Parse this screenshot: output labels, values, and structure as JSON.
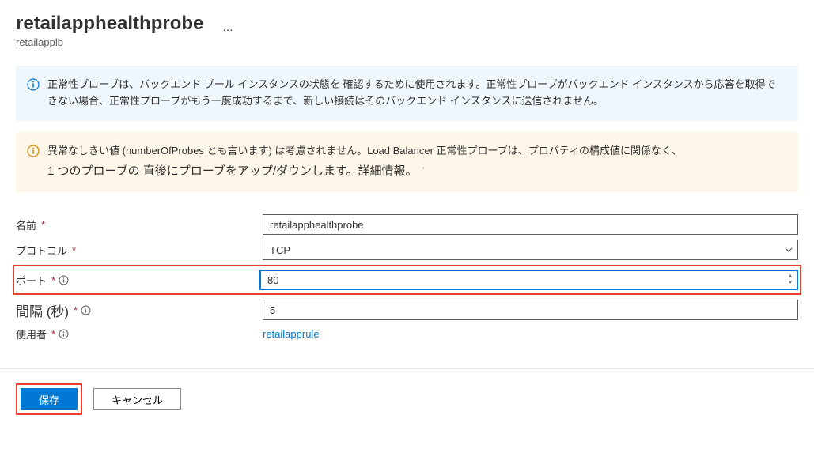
{
  "header": {
    "title": "retailapphealthprobe",
    "subtitle": "retailapplb",
    "ellipsis": "…"
  },
  "info1": {
    "text": "正常性プローブは、バックエンド プール インスタンスの状態を 確認するために使用されます。正常性プローブがバックエンド インスタンスから応答を取得できない場合、正常性プローブがもう一度成功するまで、新しい接続はそのバックエンド インスタンスに送信されません。"
  },
  "info2": {
    "text": "異常なしきい値 (numberOfProbes とも言います) は考慮されません。Load Balancer 正常性プローブは、プロパティの構成値に関係なく、",
    "text2": "1 つのプローブの 直後にプローブをアップ/ダウンします。詳細情報。"
  },
  "form": {
    "name": {
      "label": "名前",
      "value": "retailapphealthprobe"
    },
    "protocol": {
      "label": "プロトコル",
      "value": "TCP"
    },
    "port": {
      "label": "ポート",
      "value": "80"
    },
    "interval": {
      "label": "間隔 (秒)",
      "value": "5"
    },
    "usedBy": {
      "label": "使用者",
      "value": "retailapprule"
    }
  },
  "footer": {
    "save": "保存",
    "cancel": "キャンセル"
  },
  "icons": {
    "info": "info-icon",
    "warn": "warn-icon",
    "chevronDown": "chevron-down-icon",
    "infoSmall": "info-small-icon"
  },
  "colors": {
    "primary": "#0078d4",
    "highlight": "#e83e2f",
    "infoBg": "#eff6fc",
    "warnBg": "#fef6e9"
  }
}
